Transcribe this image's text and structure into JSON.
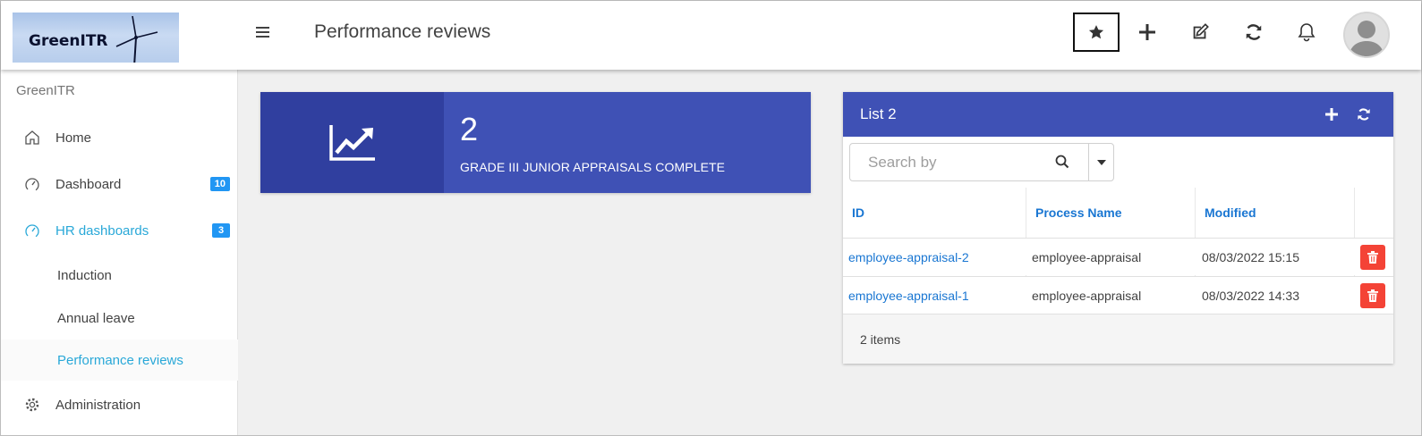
{
  "app": {
    "logo_text": "GreenITR",
    "page_title": "Performance reviews"
  },
  "header": {
    "actions": [
      {
        "icon": "star-icon",
        "focused": true
      },
      {
        "icon": "plus-icon"
      },
      {
        "icon": "edit-icon"
      },
      {
        "icon": "refresh-icon"
      },
      {
        "icon": "bell-icon"
      }
    ]
  },
  "sidebar": {
    "brand": "GreenITR",
    "items": [
      {
        "label": "Home",
        "icon": "home-icon"
      },
      {
        "label": "Dashboard",
        "icon": "gauge-icon",
        "badge": "10"
      },
      {
        "label": "HR dashboards",
        "icon": "gauge-icon",
        "badge": "3",
        "active": true
      },
      {
        "label": "Induction"
      },
      {
        "label": "Annual leave"
      },
      {
        "label": "Performance reviews",
        "selected": true
      },
      {
        "label": "Administration",
        "icon": "gear-icon"
      }
    ]
  },
  "kpi": {
    "value": "2",
    "label": "GRADE III JUNIOR APPRAISALS COMPLETE",
    "icon": "trending-up-icon"
  },
  "list": {
    "title": "List 2",
    "search_placeholder": "Search by",
    "columns": [
      "ID",
      "Process Name",
      "Modified"
    ],
    "rows": [
      {
        "id": "employee-appraisal-2",
        "process": "employee-appraisal",
        "modified": "08/03/2022 15:15"
      },
      {
        "id": "employee-appraisal-1",
        "process": "employee-appraisal",
        "modified": "08/03/2022 14:33"
      }
    ],
    "footer": "2 items"
  },
  "colors": {
    "primary": "#3f51b5",
    "primary_dark": "#303f9f",
    "accent_link": "#1976d2",
    "active_nav": "#29a8d8",
    "badge": "#2196f3",
    "danger": "#f44336"
  }
}
